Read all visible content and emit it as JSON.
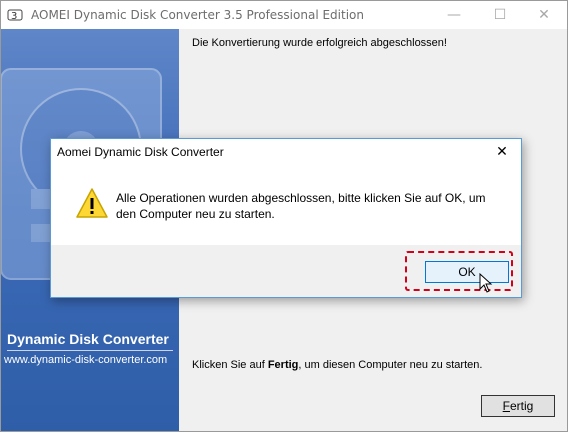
{
  "window": {
    "title": "AOMEI Dynamic Disk Converter 3.5 Professional Edition",
    "min_glyph": "—",
    "max_glyph": "☐",
    "close_glyph": "✕"
  },
  "sidebar": {
    "product_name": "Dynamic Disk Converter",
    "url": "www.dynamic-disk-converter.com"
  },
  "main": {
    "success_message": "Die Konvertierung wurde erfolgreich abgeschlossen!",
    "finish_prefix": "Klicken Sie auf ",
    "finish_bold": "Fertig",
    "finish_suffix": ", um diesen Computer neu zu starten.",
    "finish_button_first": "F",
    "finish_button_rest": "ertig"
  },
  "dialog": {
    "title": "Aomei Dynamic Disk Converter",
    "close_glyph": "✕",
    "message": "Alle Operationen wurden abgeschlossen, bitte klicken Sie auf OK, um den Computer neu zu starten.",
    "ok_label": "OK"
  },
  "colors": {
    "accent": "#0078d7",
    "highlight": "#d0021b",
    "sidebar": "#3c6ab7"
  },
  "icons": {
    "app": "app-icon",
    "warning": "warning-icon",
    "cursor": "mouse-cursor-icon"
  }
}
